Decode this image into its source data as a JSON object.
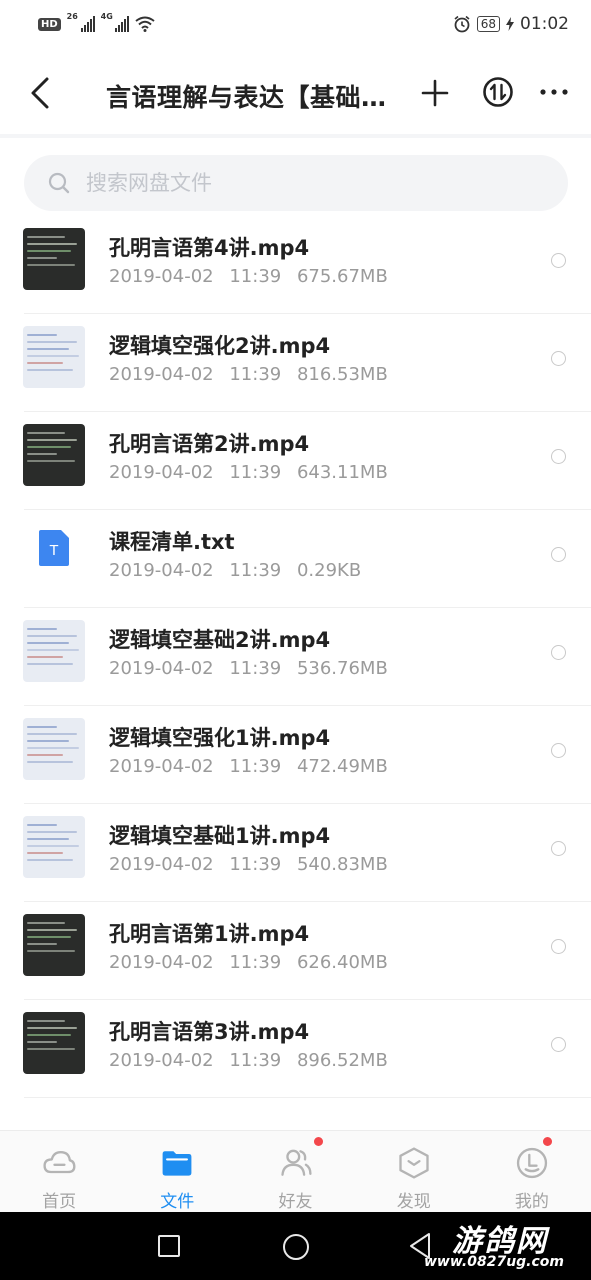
{
  "status_bar": {
    "hd": "HD",
    "sim1": "26",
    "sim2": "4G",
    "battery": "68",
    "time": "01:02"
  },
  "header": {
    "title": "言语理解与表达【基础…"
  },
  "search": {
    "placeholder": "搜索网盘文件"
  },
  "files": [
    {
      "name": "孔明言语第4讲.mp4",
      "date": "2019-04-02",
      "time": "11:39",
      "size": "675.67MB",
      "thumb": "dark-video"
    },
    {
      "name": "逻辑填空强化2讲.mp4",
      "date": "2019-04-02",
      "time": "11:39",
      "size": "816.53MB",
      "thumb": "light-slide"
    },
    {
      "name": "孔明言语第2讲.mp4",
      "date": "2019-04-02",
      "time": "11:39",
      "size": "643.11MB",
      "thumb": "dark-video"
    },
    {
      "name": "课程清单.txt",
      "date": "2019-04-02",
      "time": "11:39",
      "size": "0.29KB",
      "thumb": "txt-icon",
      "icon_letter": "T"
    },
    {
      "name": "逻辑填空基础2讲.mp4",
      "date": "2019-04-02",
      "time": "11:39",
      "size": "536.76MB",
      "thumb": "light-slide"
    },
    {
      "name": "逻辑填空强化1讲.mp4",
      "date": "2019-04-02",
      "time": "11:39",
      "size": "472.49MB",
      "thumb": "light-slide"
    },
    {
      "name": "逻辑填空基础1讲.mp4",
      "date": "2019-04-02",
      "time": "11:39",
      "size": "540.83MB",
      "thumb": "light-slide"
    },
    {
      "name": "孔明言语第1讲.mp4",
      "date": "2019-04-02",
      "time": "11:39",
      "size": "626.40MB",
      "thumb": "dark-video"
    },
    {
      "name": "孔明言语第3讲.mp4",
      "date": "2019-04-02",
      "time": "11:39",
      "size": "896.52MB",
      "thumb": "dark-video"
    }
  ],
  "bottom_nav": [
    {
      "label": "首页",
      "icon": "cloud-icon",
      "active": false,
      "badge": false
    },
    {
      "label": "文件",
      "icon": "folder-icon",
      "active": true,
      "badge": false
    },
    {
      "label": "好友",
      "icon": "friends-icon",
      "active": false,
      "badge": true
    },
    {
      "label": "发现",
      "icon": "discover-icon",
      "active": false,
      "badge": false
    },
    {
      "label": "我的",
      "icon": "profile-icon",
      "active": false,
      "badge": true
    }
  ],
  "watermark": {
    "title": "游鸽网",
    "url": "www.0827ug.com"
  },
  "colors": {
    "accent": "#1f8ef1",
    "badge": "#f3474b",
    "txt_icon": "#3d86f0"
  }
}
